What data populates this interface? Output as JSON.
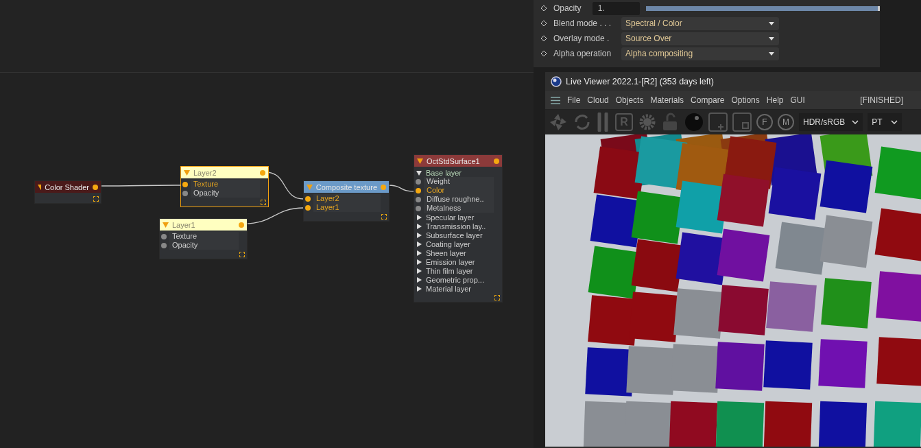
{
  "attributes": {
    "opacity": {
      "label": "Opacity",
      "value": "1.",
      "level": 1
    },
    "dropdowns": [
      {
        "label": "Blend mode . . .",
        "value": "Spectral / Color"
      },
      {
        "label": "Overlay mode .",
        "value": "Source Over"
      },
      {
        "label": "Alpha operation",
        "value": "Alpha compositing"
      }
    ]
  },
  "nodes": [
    {
      "title": "Color Shader",
      "color": "#4a1a1a",
      "selected": false
    },
    {
      "title": "Layer2",
      "color": "#ffffc0",
      "selected": true,
      "rows": [
        {
          "kind": "port",
          "label": "Texture",
          "connected": true
        },
        {
          "kind": "port",
          "label": "Opacity",
          "connected": false
        }
      ]
    },
    {
      "title": "Layer1",
      "color": "#ffffc0",
      "selected": false,
      "rows": [
        {
          "kind": "port",
          "label": "Texture",
          "connected": false
        },
        {
          "kind": "port",
          "label": "Opacity",
          "connected": false
        }
      ]
    },
    {
      "title": "Composite texture",
      "color": "#6b9ac8",
      "selected": false,
      "rows": [
        {
          "kind": "port",
          "label": "Layer2",
          "connected": true
        },
        {
          "kind": "port",
          "label": "Layer1",
          "connected": true
        }
      ]
    },
    {
      "title": "OctStdSurface1",
      "color": "#8c3a3a",
      "selected": false,
      "rows": [
        {
          "kind": "section",
          "label": "Base layer",
          "expanded": true,
          "children": [
            {
              "kind": "port",
              "label": "Weight",
              "connected": false
            },
            {
              "kind": "port",
              "label": "Color",
              "connected": true
            },
            {
              "kind": "port",
              "label": "Diffuse roughne..",
              "connected": false
            },
            {
              "kind": "port",
              "label": "Metalness",
              "connected": false
            }
          ]
        },
        {
          "kind": "section",
          "label": "Specular layer",
          "expanded": false
        },
        {
          "kind": "section",
          "label": "Transmission lay..",
          "expanded": false
        },
        {
          "kind": "section",
          "label": "Subsurface layer",
          "expanded": false
        },
        {
          "kind": "section",
          "label": "Coating layer",
          "expanded": false
        },
        {
          "kind": "section",
          "label": "Sheen layer",
          "expanded": false
        },
        {
          "kind": "section",
          "label": "Emission layer",
          "expanded": false
        },
        {
          "kind": "section",
          "label": "Thin film layer",
          "expanded": false
        },
        {
          "kind": "section",
          "label": "Geometric prop...",
          "expanded": false
        },
        {
          "kind": "section",
          "label": "Material layer",
          "expanded": false
        }
      ]
    }
  ],
  "viewer": {
    "title": "Live Viewer 2022.1-[R2] (353 days left)",
    "menu": [
      "File",
      "Cloud",
      "Objects",
      "Materials",
      "Compare",
      "Options",
      "Help",
      "GUI"
    ],
    "status": "[FINISHED]",
    "toolbar": [
      {
        "kind": "aperture"
      },
      {
        "kind": "refresh"
      },
      {
        "kind": "pause"
      },
      {
        "kind": "letter",
        "text": "R"
      },
      {
        "kind": "gear"
      },
      {
        "kind": "lock"
      },
      {
        "kind": "sphere"
      },
      {
        "kind": "add"
      },
      {
        "kind": "region"
      },
      {
        "kind": "pin",
        "text": "F"
      },
      {
        "kind": "pin",
        "text": "M"
      }
    ],
    "selects": [
      "HDR/sRGB",
      "PT"
    ]
  }
}
